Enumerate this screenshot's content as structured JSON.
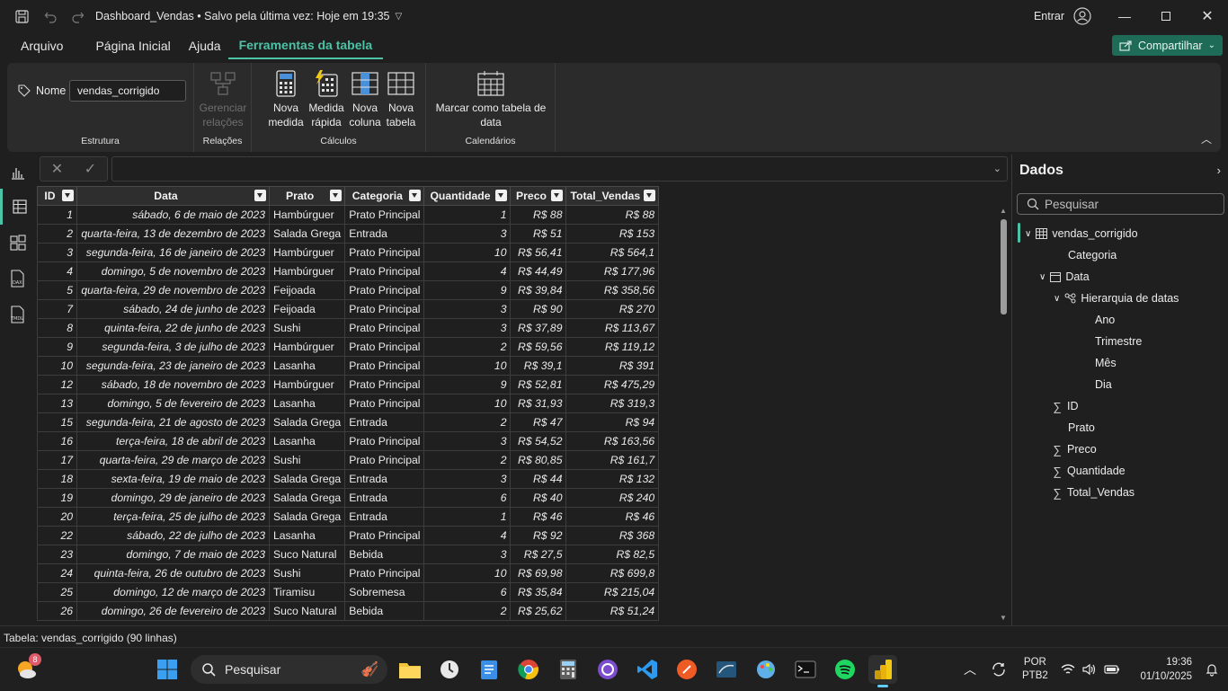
{
  "window": {
    "title": "Dashboard_Vendas • Salvo pela última vez: Hoje em 19:35",
    "signin_label": "Entrar"
  },
  "menu": {
    "items": [
      "Arquivo",
      "Página Inicial",
      "Ajuda",
      "Ferramentas da tabela"
    ],
    "active_index": 3,
    "share_label": "Compartilhar"
  },
  "ribbon": {
    "name_label": "Nome",
    "name_value": "vendas_corrigido",
    "groups": {
      "estrutura": "Estrutura",
      "relacoes": "Relações",
      "calculos": "Cálculos",
      "calendarios": "Calendários"
    },
    "buttons": {
      "manage_relations": [
        "Gerenciar",
        "relações"
      ],
      "new_measure": [
        "Nova",
        "medida"
      ],
      "quick_measure": [
        "Medida",
        "rápida"
      ],
      "new_column": [
        "Nova",
        "coluna"
      ],
      "new_table": [
        "Nova",
        "tabela"
      ],
      "mark_date_table": [
        "Marcar como tabela de",
        "data"
      ]
    }
  },
  "table": {
    "columns": [
      "ID",
      "Data",
      "Prato",
      "Categoria",
      "Quantidade",
      "Preco",
      "Total_Vendas"
    ],
    "rows": [
      [
        "1",
        "sábado, 6 de maio de 2023",
        "Hambúrguer",
        "Prato Principal",
        "1",
        "R$ 88",
        "R$ 88"
      ],
      [
        "2",
        "quarta-feira, 13 de dezembro de 2023",
        "Salada Grega",
        "Entrada",
        "3",
        "R$ 51",
        "R$ 153"
      ],
      [
        "3",
        "segunda-feira, 16 de janeiro de 2023",
        "Hambúrguer",
        "Prato Principal",
        "10",
        "R$ 56,41",
        "R$ 564,1"
      ],
      [
        "4",
        "domingo, 5 de novembro de 2023",
        "Hambúrguer",
        "Prato Principal",
        "4",
        "R$ 44,49",
        "R$ 177,96"
      ],
      [
        "5",
        "quarta-feira, 29 de novembro de 2023",
        "Feijoada",
        "Prato Principal",
        "9",
        "R$ 39,84",
        "R$ 358,56"
      ],
      [
        "7",
        "sábado, 24 de junho de 2023",
        "Feijoada",
        "Prato Principal",
        "3",
        "R$ 90",
        "R$ 270"
      ],
      [
        "8",
        "quinta-feira, 22 de junho de 2023",
        "Sushi",
        "Prato Principal",
        "3",
        "R$ 37,89",
        "R$ 113,67"
      ],
      [
        "9",
        "segunda-feira, 3 de julho de 2023",
        "Hambúrguer",
        "Prato Principal",
        "2",
        "R$ 59,56",
        "R$ 119,12"
      ],
      [
        "10",
        "segunda-feira, 23 de janeiro de 2023",
        "Lasanha",
        "Prato Principal",
        "10",
        "R$ 39,1",
        "R$ 391"
      ],
      [
        "12",
        "sábado, 18 de novembro de 2023",
        "Hambúrguer",
        "Prato Principal",
        "9",
        "R$ 52,81",
        "R$ 475,29"
      ],
      [
        "13",
        "domingo, 5 de fevereiro de 2023",
        "Lasanha",
        "Prato Principal",
        "10",
        "R$ 31,93",
        "R$ 319,3"
      ],
      [
        "15",
        "segunda-feira, 21 de agosto de 2023",
        "Salada Grega",
        "Entrada",
        "2",
        "R$ 47",
        "R$ 94"
      ],
      [
        "16",
        "terça-feira, 18 de abril de 2023",
        "Lasanha",
        "Prato Principal",
        "3",
        "R$ 54,52",
        "R$ 163,56"
      ],
      [
        "17",
        "quarta-feira, 29 de março de 2023",
        "Sushi",
        "Prato Principal",
        "2",
        "R$ 80,85",
        "R$ 161,7"
      ],
      [
        "18",
        "sexta-feira, 19 de maio de 2023",
        "Salada Grega",
        "Entrada",
        "3",
        "R$ 44",
        "R$ 132"
      ],
      [
        "19",
        "domingo, 29 de janeiro de 2023",
        "Salada Grega",
        "Entrada",
        "6",
        "R$ 40",
        "R$ 240"
      ],
      [
        "20",
        "terça-feira, 25 de julho de 2023",
        "Salada Grega",
        "Entrada",
        "1",
        "R$ 46",
        "R$ 46"
      ],
      [
        "22",
        "sábado, 22 de julho de 2023",
        "Lasanha",
        "Prato Principal",
        "4",
        "R$ 92",
        "R$ 368"
      ],
      [
        "23",
        "domingo, 7 de maio de 2023",
        "Suco Natural",
        "Bebida",
        "3",
        "R$ 27,5",
        "R$ 82,5"
      ],
      [
        "24",
        "quinta-feira, 26 de outubro de 2023",
        "Sushi",
        "Prato Principal",
        "10",
        "R$ 69,98",
        "R$ 699,8"
      ],
      [
        "25",
        "domingo, 12 de março de 2023",
        "Tiramisu",
        "Sobremesa",
        "6",
        "R$ 35,84",
        "R$ 215,04"
      ],
      [
        "26",
        "domingo, 26 de fevereiro de 2023",
        "Suco Natural",
        "Bebida",
        "2",
        "R$ 25,62",
        "R$ 51,24"
      ]
    ]
  },
  "data_panel": {
    "title": "Dados",
    "search_placeholder": "Pesquisar",
    "table_name": "vendas_corrigido",
    "fields": {
      "categoria": "Categoria",
      "data": "Data",
      "hierarquia": "Hierarquia de datas",
      "ano": "Ano",
      "trimestre": "Trimestre",
      "mes": "Mês",
      "dia": "Dia",
      "id": "ID",
      "prato": "Prato",
      "preco": "Preco",
      "quantidade": "Quantidade",
      "total_vendas": "Total_Vendas"
    }
  },
  "status": {
    "text": "Tabela: vendas_corrigido (90 linhas)"
  },
  "taskbar": {
    "search_label": "Pesquisar",
    "weather_badge": "8",
    "lang_line1": "POR",
    "lang_line2": "PTB2",
    "time": "19:36",
    "date": "01/10/2025"
  }
}
